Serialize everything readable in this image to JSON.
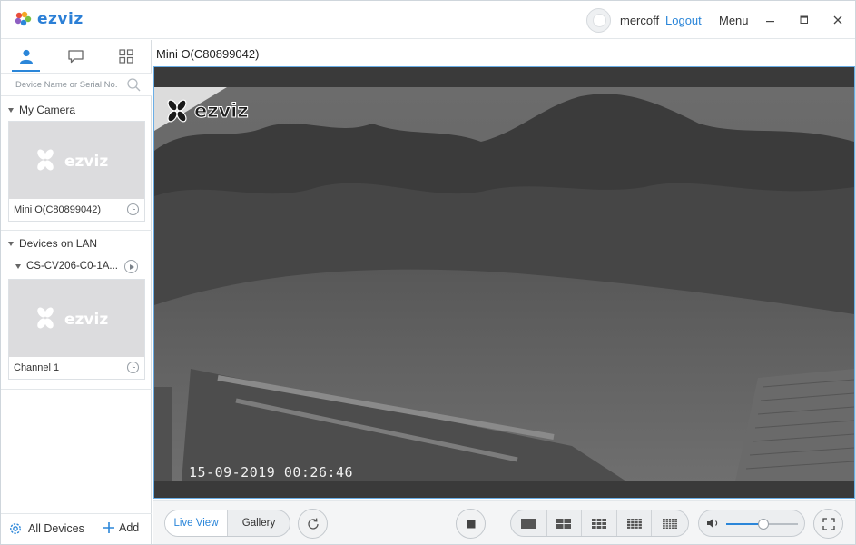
{
  "app": {
    "brand": "ezviz",
    "username": "mercoff",
    "logout_label": "Logout",
    "menu_label": "Menu",
    "accent_color": "#2b86d9"
  },
  "sidebar": {
    "search_placeholder": "Device Name or Serial No.",
    "my_camera": {
      "header": "My Camera",
      "devices": [
        {
          "name": "Mini O(C80899042)"
        }
      ]
    },
    "lan": {
      "header": "Devices on LAN",
      "device": "CS-CV206-C0-1A...",
      "channels": [
        {
          "name": "Channel 1"
        }
      ]
    },
    "footer": {
      "all_devices_label": "All Devices",
      "add_label": "Add"
    }
  },
  "main": {
    "title": "Mini O(C80899042)",
    "video": {
      "timestamp": "15-09-2019 00:26:46",
      "watermark": "ezviz"
    }
  },
  "controls": {
    "view_modes": [
      "Live View",
      "Gallery"
    ],
    "active_mode": "Live View",
    "volume_percent": 52
  }
}
